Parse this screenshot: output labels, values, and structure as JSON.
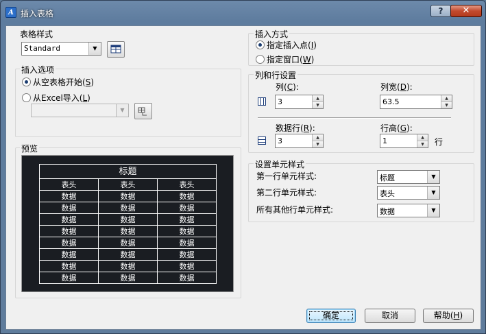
{
  "window": {
    "title": "插入表格",
    "help_glyph": "?",
    "close_glyph": "✕"
  },
  "table_style": {
    "label": "表格样式",
    "value": "Standard"
  },
  "insert_options": {
    "label": "插入选项",
    "empty_table": "从空表格开始",
    "empty_table_key": "S",
    "from_excel": "从Excel导入",
    "from_excel_key": "L"
  },
  "preview": {
    "label": "预览",
    "title": "标题",
    "headers": [
      "表头",
      "表头",
      "表头"
    ],
    "rows": [
      [
        "数据",
        "数据",
        "数据"
      ],
      [
        "数据",
        "数据",
        "数据"
      ],
      [
        "数据",
        "数据",
        "数据"
      ],
      [
        "数据",
        "数据",
        "数据"
      ],
      [
        "数据",
        "数据",
        "数据"
      ],
      [
        "数据",
        "数据",
        "数据"
      ],
      [
        "数据",
        "数据",
        "数据"
      ],
      [
        "数据",
        "数据",
        "数据"
      ]
    ]
  },
  "insert_method": {
    "label": "插入方式",
    "point": "指定插入点",
    "point_key": "I",
    "window": "指定窗口",
    "window_key": "W"
  },
  "rows_cols": {
    "label": "列和行设置",
    "columns_label": "列",
    "columns_key": "C",
    "columns_value": "3",
    "col_width_label": "列宽",
    "col_width_key": "D",
    "col_width_value": "63.5",
    "data_rows_label": "数据行",
    "data_rows_key": "R",
    "data_rows_value": "3",
    "row_height_label": "行高",
    "row_height_key": "G",
    "row_height_value": "1",
    "row_unit": "行"
  },
  "cell_styles": {
    "label": "设置单元样式",
    "first_row_label": "第一行单元样式:",
    "first_row_value": "标题",
    "second_row_label": "第二行单元样式:",
    "second_row_value": "表头",
    "other_rows_label": "所有其他行单元样式:",
    "other_rows_value": "数据"
  },
  "buttons": {
    "ok": "确定",
    "cancel": "取消",
    "help": "帮助",
    "help_key": "H"
  }
}
